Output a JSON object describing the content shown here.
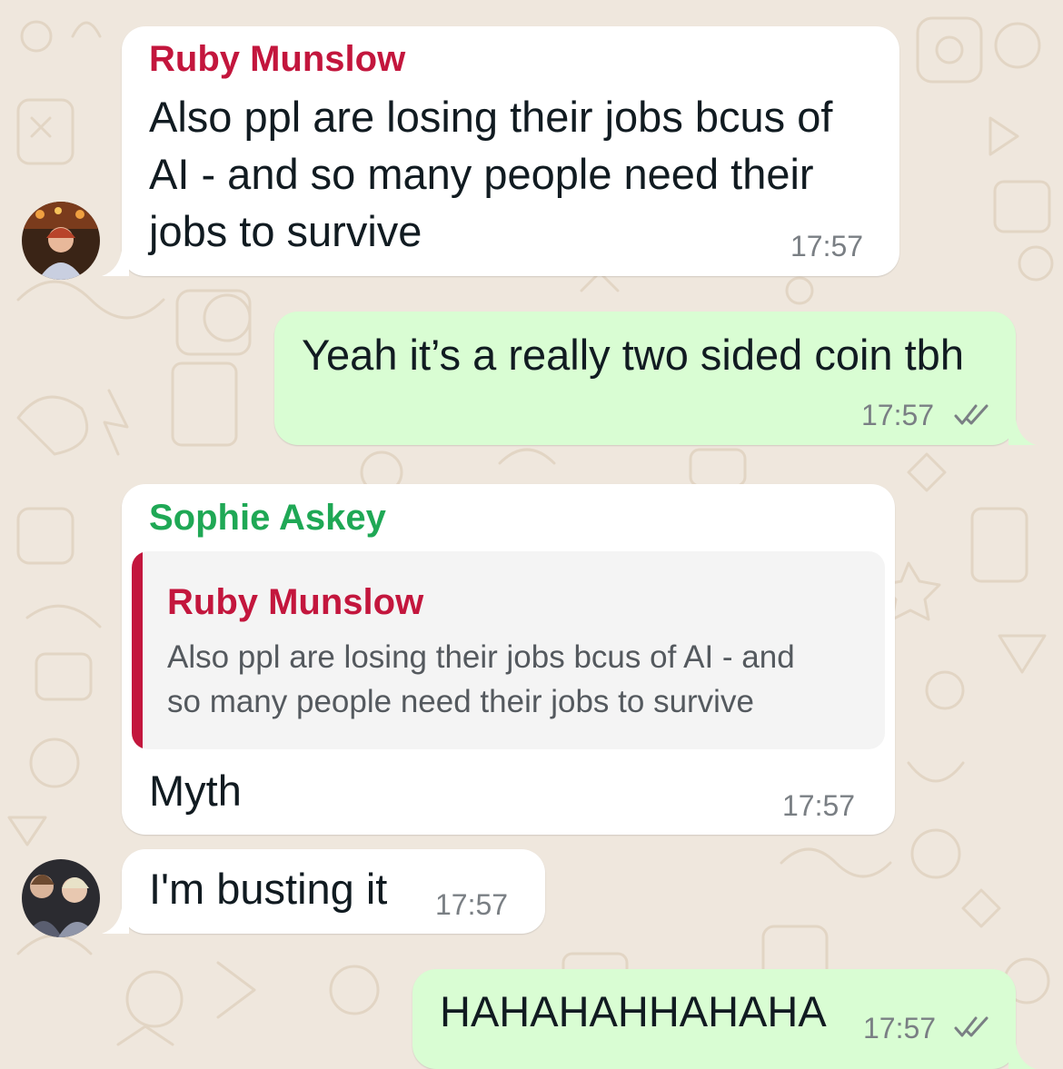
{
  "colors": {
    "ruby": "#c3163d",
    "sophie": "#1fa855",
    "incoming_bubble": "#ffffff",
    "outgoing_bubble": "#d9fdd3",
    "read_ticks": "#7a7f84"
  },
  "messages": [
    {
      "direction": "incoming",
      "sender": "Ruby Munslow",
      "text_lines": [
        "Also ppl are losing their jobs bcus of",
        "AI - and so many people need their",
        "jobs to survive"
      ],
      "time": "17:57"
    },
    {
      "direction": "outgoing",
      "text": "Yeah it’s a really two sided coin tbh",
      "time": "17:57",
      "status_icon": "double-check-icon"
    },
    {
      "direction": "incoming",
      "sender": "Sophie Askey",
      "quote": {
        "sender": "Ruby Munslow",
        "text_lines": [
          "Also ppl are losing their jobs bcus of AI - and",
          "so many people need their jobs to survive"
        ]
      },
      "text": "Myth",
      "time": "17:57"
    },
    {
      "direction": "incoming",
      "text": "I'm busting it",
      "time": "17:57"
    },
    {
      "direction": "outgoing",
      "text": "HAHAHAHHAHAHA",
      "time": "17:57",
      "status_icon": "double-check-icon"
    }
  ]
}
